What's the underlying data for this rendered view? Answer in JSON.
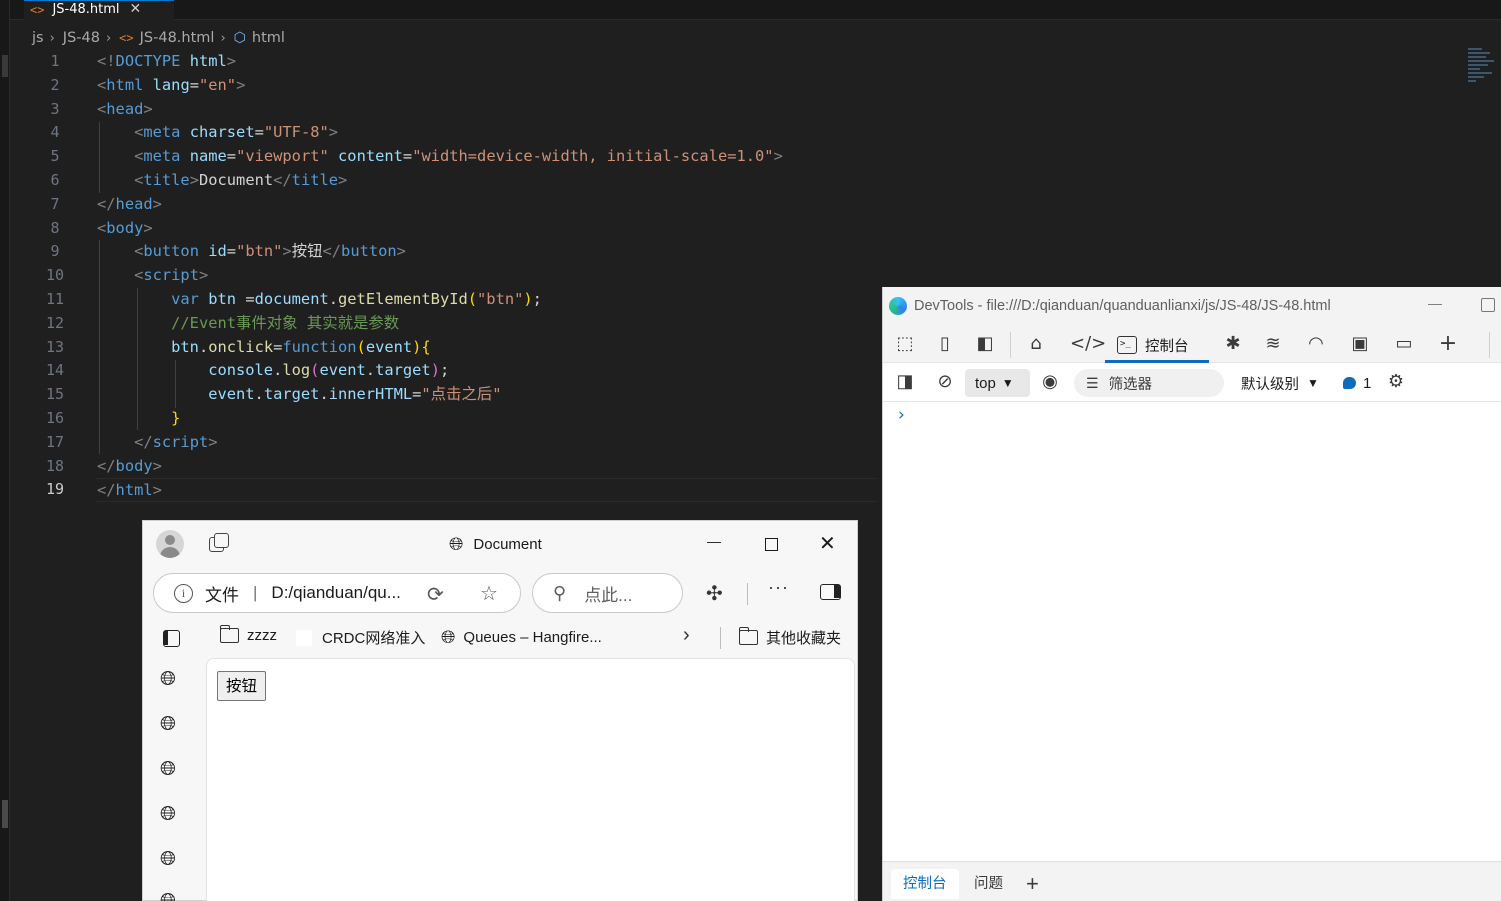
{
  "editor": {
    "tab_label": "JS-48.html",
    "breadcrumb": [
      "js",
      "JS-48",
      "JS-48.html",
      "html"
    ],
    "line_numbers": [
      "1",
      "2",
      "3",
      "4",
      "5",
      "6",
      "7",
      "8",
      "9",
      "10",
      "11",
      "12",
      "13",
      "14",
      "15",
      "16",
      "17",
      "18",
      "19"
    ],
    "active_line": 19
  },
  "devtools": {
    "title": "DevTools - file:///D:/qianduan/quanduanlianxi/js/JS-48/JS-48.html",
    "console_tab": "控制台",
    "context": "top",
    "filter_placeholder": "筛选器",
    "levels": "默认级别",
    "issues_count": "1",
    "prompt": "›",
    "drawer_tabs": [
      "控制台",
      "问题"
    ]
  },
  "browser": {
    "tab_title": "Document",
    "address_label": "文件",
    "address_url": "D:/qianduan/qu...",
    "search_placeholder": "点此...",
    "favorites": [
      "zzzz",
      "CRDC网络准入",
      "Queues – Hangfire...",
      "其他收藏夹"
    ],
    "page_button_label": "按钮"
  },
  "colors": {
    "editor_bg": "#1f1f1f",
    "accent": "#0f6cbd",
    "tag_name": "#569cd6",
    "attribute": "#9cdcfe",
    "string": "#ce9178",
    "comment": "#6a9955"
  }
}
